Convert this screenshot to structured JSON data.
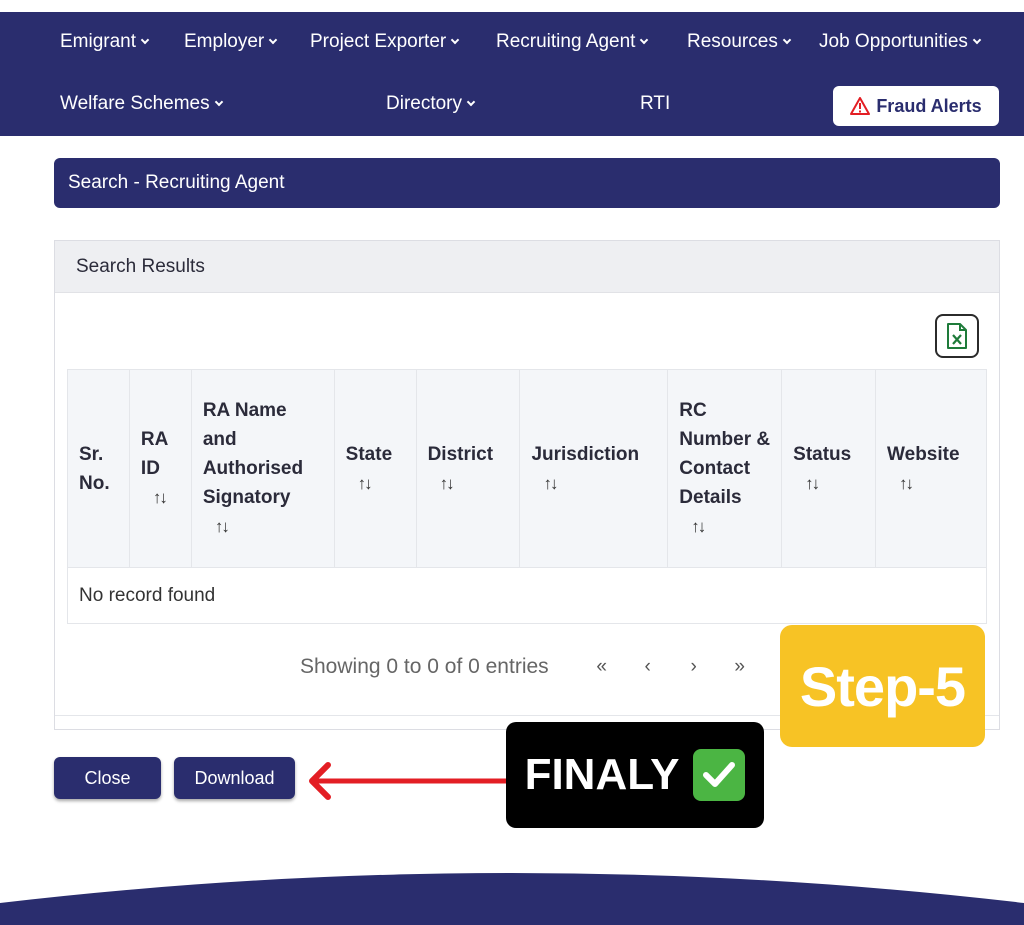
{
  "nav": {
    "row1": [
      {
        "label": "Emigrant",
        "dropdown": true
      },
      {
        "label": "Employer",
        "dropdown": true
      },
      {
        "label": "Project Exporter",
        "dropdown": true
      },
      {
        "label": "Recruiting Agent",
        "dropdown": true
      },
      {
        "label": "Resources",
        "dropdown": true
      },
      {
        "label": "Job Opportunities",
        "dropdown": true
      }
    ],
    "row2": [
      {
        "label": "Welfare Schemes",
        "dropdown": true
      },
      {
        "label": "Directory",
        "dropdown": true
      },
      {
        "label": "RTI",
        "dropdown": false
      }
    ],
    "fraud_alerts": "Fraud Alerts"
  },
  "page_title": "Search - Recruiting Agent",
  "results": {
    "title": "Search Results",
    "excel_icon": "excel-export-icon",
    "columns": [
      "Sr. No.",
      "RA ID",
      "RA Name and Authorised Signatory",
      "State",
      "District",
      "Jurisdiction",
      "RC Number & Contact Details",
      "Status",
      "Website"
    ],
    "empty_message": "No record found",
    "pagination": {
      "info": "Showing 0 to 0 of 0 entries",
      "first": "«",
      "prev": "‹",
      "next": "›",
      "last": "»"
    }
  },
  "actions": {
    "close": "Close",
    "download": "Download"
  },
  "annotations": {
    "step": "Step-5",
    "finaly": "FINALY"
  },
  "colors": {
    "brand_navy": "#2a2d6e",
    "step_yellow": "#f7c325",
    "arrow_red": "#e31e24",
    "check_green": "#4bb543"
  }
}
